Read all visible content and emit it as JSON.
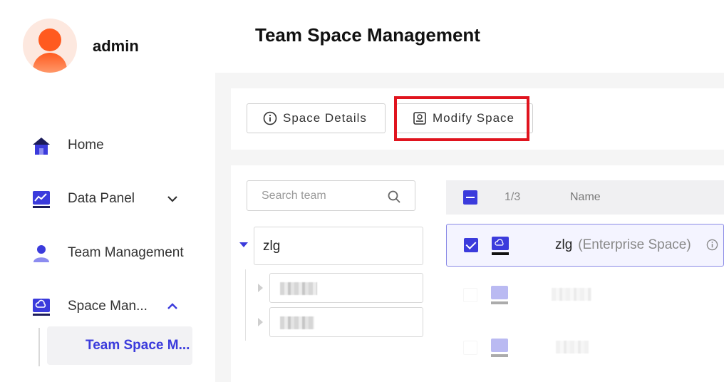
{
  "user": {
    "name": "admin"
  },
  "nav": {
    "items": [
      {
        "label": "Home",
        "icon": "home-icon"
      },
      {
        "label": "Data Panel",
        "icon": "chart-icon",
        "expand": "chevron-down-icon"
      },
      {
        "label": "Team Management",
        "icon": "user-icon"
      },
      {
        "label": "Space Man...",
        "icon": "cloud-storage-icon",
        "expand": "chevron-up-icon"
      }
    ],
    "sub_items": [
      {
        "label": "Team Space M..."
      }
    ]
  },
  "page": {
    "title": "Team Space Management"
  },
  "toolbar": {
    "details_label": "Space Details",
    "modify_label": "Modify Space"
  },
  "tree": {
    "search_placeholder": "Search team",
    "root": {
      "label": "zlg"
    }
  },
  "list": {
    "selection_count": "1/3",
    "column_name": "Name",
    "rows": [
      {
        "name": "zlg",
        "type": "(Enterprise Space)",
        "selected": true
      }
    ]
  },
  "colors": {
    "accent": "#3b3bdc",
    "highlight": "#e0141e",
    "avatar": "#ff5a1f"
  }
}
